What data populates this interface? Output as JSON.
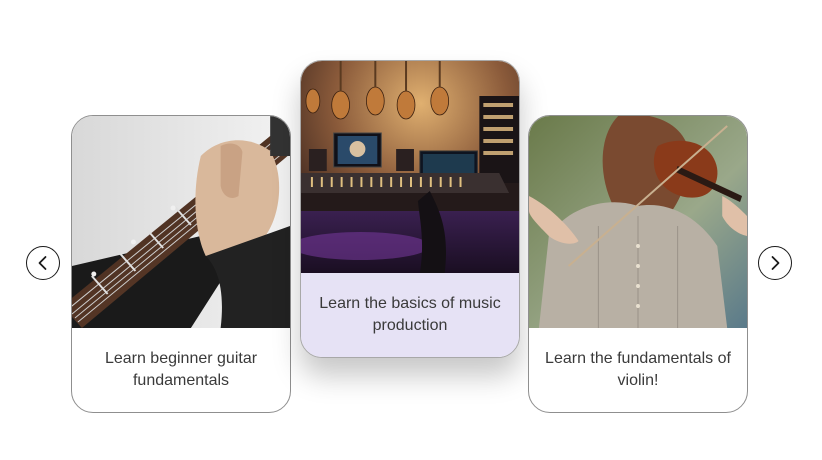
{
  "carousel": {
    "prev_label": "Previous",
    "next_label": "Next",
    "cards": [
      {
        "caption": "Learn beginner guitar fundamentals",
        "image": "guitar-chord-photo"
      },
      {
        "caption": "Learn the basics of music production",
        "image": "recording-studio-photo"
      },
      {
        "caption": "Learn the fundamentals of violin!",
        "image": "violin-player-photo"
      }
    ],
    "active_index": 1
  },
  "colors": {
    "active_caption_bg": "#e6e2f5",
    "card_border": "#8f8f8f",
    "caption_text": "#3a3a3a"
  },
  "icons": {
    "prev": "chevron-left-icon",
    "next": "chevron-right-icon"
  }
}
